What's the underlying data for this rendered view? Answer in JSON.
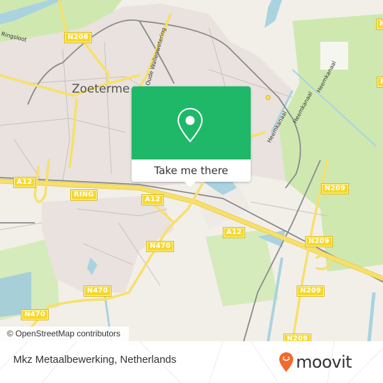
{
  "map": {
    "city_label": "Zoetermeer",
    "city_label_visible": "Zoeterme",
    "road_shields": [
      {
        "ref": "N206"
      },
      {
        "ref": "A12"
      },
      {
        "ref": "RING"
      },
      {
        "ref": "A12"
      },
      {
        "ref": "A12"
      },
      {
        "ref": "N470"
      },
      {
        "ref": "N470"
      },
      {
        "ref": "N470"
      },
      {
        "ref": "N209"
      },
      {
        "ref": "N209"
      },
      {
        "ref": "N209"
      },
      {
        "ref": "N209"
      },
      {
        "ref": "N"
      },
      {
        "ref": "N"
      }
    ],
    "street_labels": {
      "ringsloot": "Ringsloot",
      "oude_wallenweg": "Oude Wallenwetering",
      "heemkanaal_1": "Heemkanaal",
      "heemkanaal_2": "Heemkanaal",
      "heemkanaal_3": "Heemkanaal"
    },
    "colors": {
      "land": "#f2efe9",
      "residential": "#e8e0dc",
      "grass": "#cfe8b0",
      "water": "#aad3df",
      "motorway": "#f7e06a",
      "rail": "#8a8a8a"
    }
  },
  "popup": {
    "action_label": "Take me there",
    "icon": "map-pin-icon",
    "accent_color": "#1fb868"
  },
  "attribution": {
    "text": "© OpenStreetMap contributors"
  },
  "footer": {
    "place_name": "Mkz Metaalbewerking, Netherlands",
    "brand_name": "moovit",
    "brand_icon": "moovit-pin-icon",
    "brand_color": "#f26a2e"
  }
}
